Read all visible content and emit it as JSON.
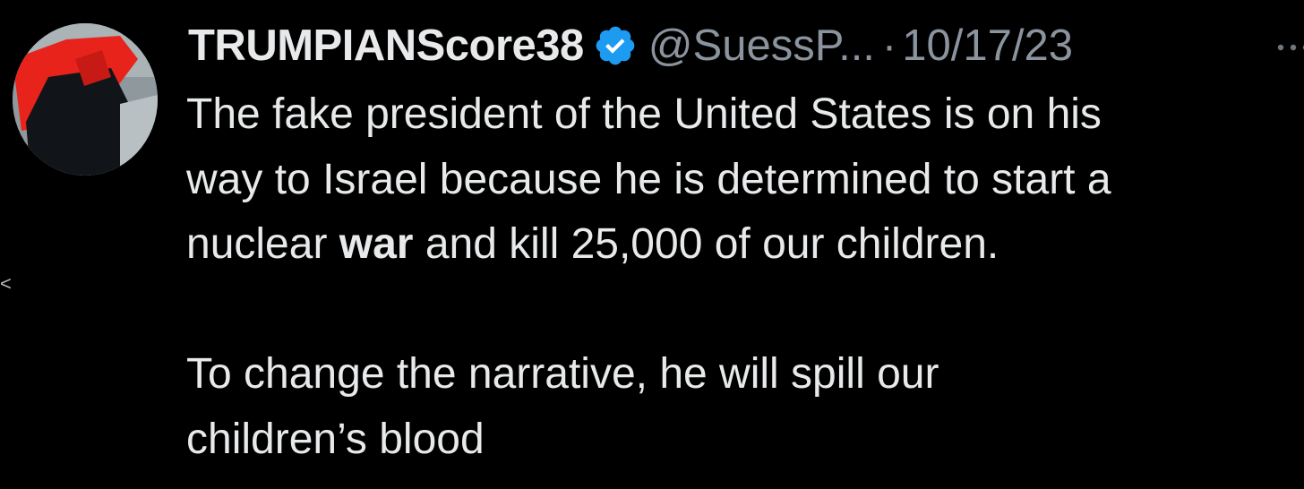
{
  "tweet": {
    "display_name": "TRUMPIANScore38",
    "handle": "@SuessP...",
    "separator": "·",
    "timestamp": "10/17/23",
    "verified": true,
    "accent_color": "#1d9bf0",
    "avatar_icon": "user-avatar-photo",
    "more_icon": "more-options-icon",
    "body": {
      "line1": "The fake president of the United States is on his",
      "line2": "way to Israel because he is determined to start a",
      "line3_before": "nuclear ",
      "line3_bold": "war",
      "line3_after": " and kill 25,000 of our children.",
      "line4": "To change the narrative, he will spill our",
      "line5": "children’s blood"
    }
  },
  "edge_glyph": "<"
}
